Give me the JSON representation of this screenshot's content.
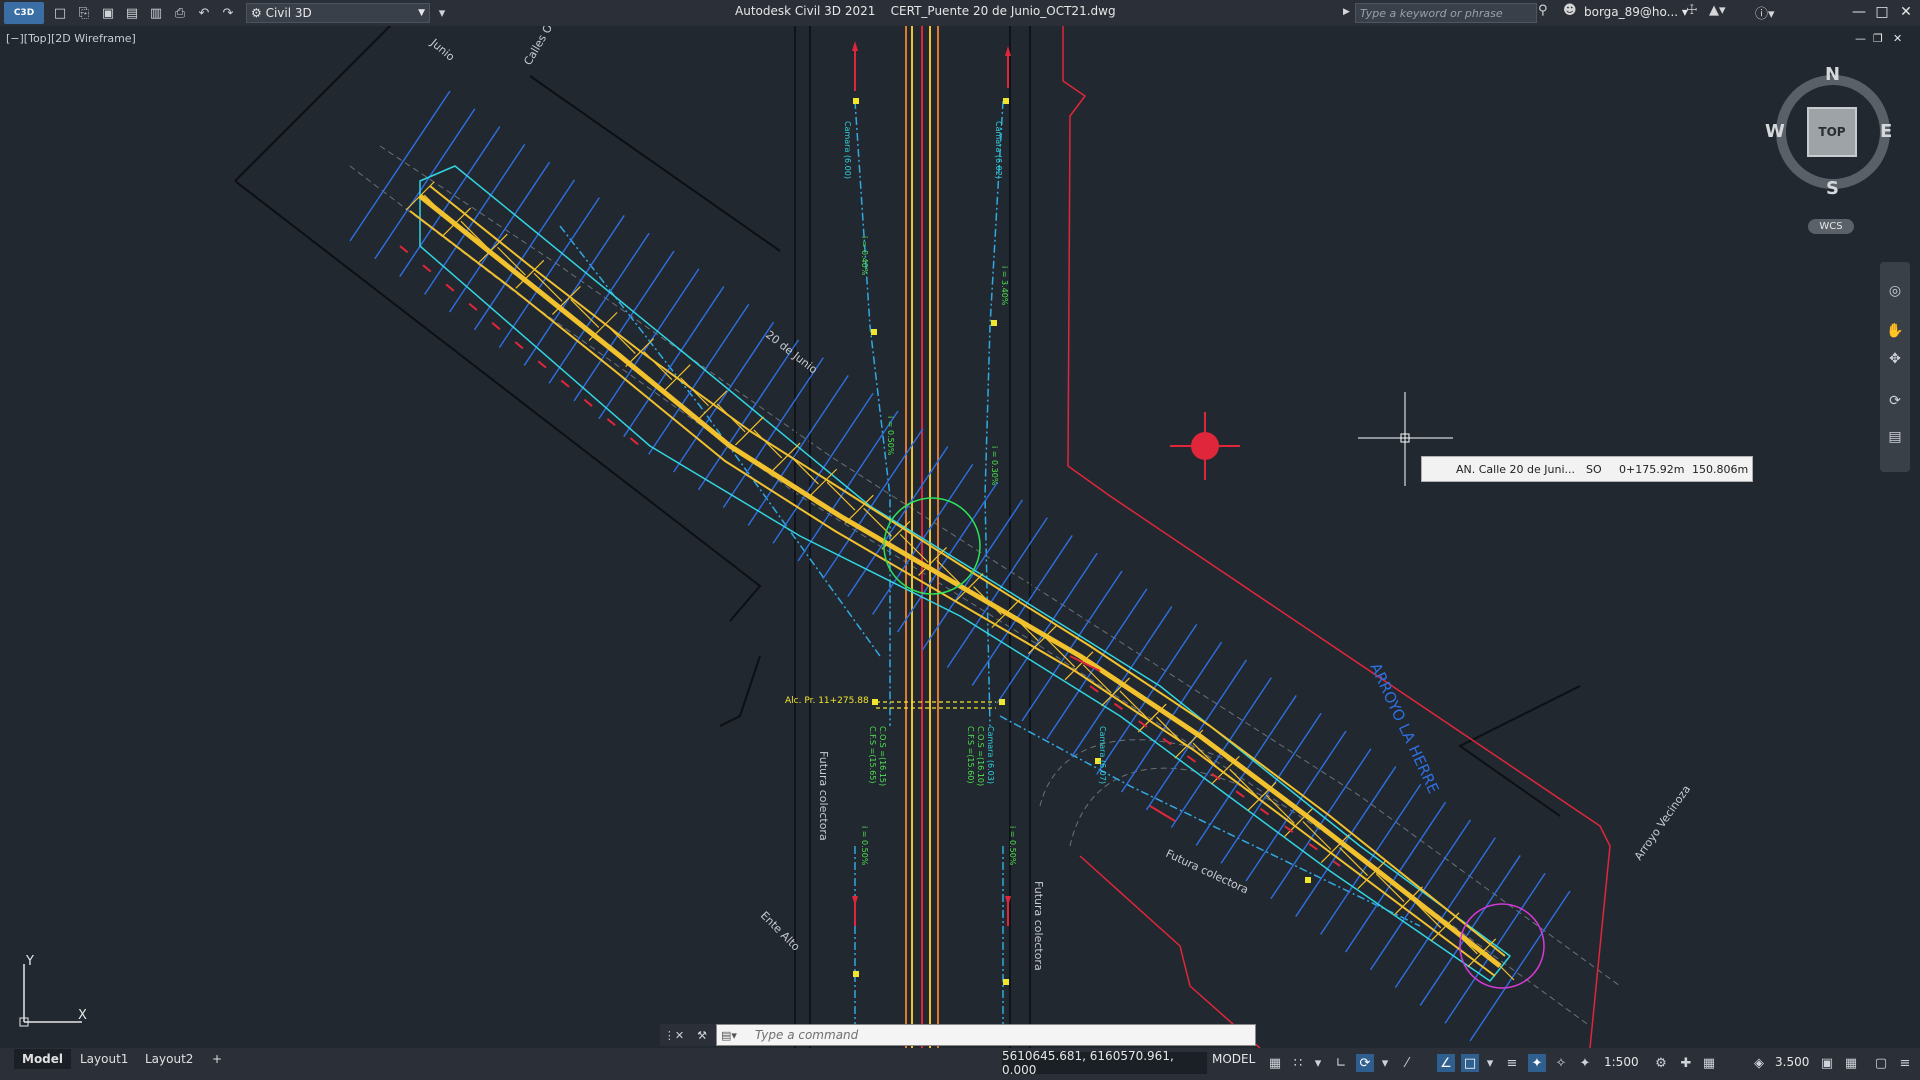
{
  "titlebar": {
    "app_badge": "C3D",
    "workspace": "Civil 3D",
    "app_name": "Autodesk Civil 3D 2021",
    "file_name": "CERT_Puente 20 de Junio_OCT21.dwg",
    "search_placeholder": "Type a keyword or phrase",
    "user": "borga_89@ho..."
  },
  "viewport": {
    "label": "[−][Top][2D Wireframe]"
  },
  "viewcube": {
    "top": "TOP",
    "north": "N",
    "south": "S",
    "east": "E",
    "west": "W",
    "wcs": "WCS"
  },
  "tooltip": {
    "alignment": "AN. Calle 20 de Juni...",
    "offset_side": "SO",
    "station": "0+175.92m",
    "offset": "150.806m"
  },
  "drawing": {
    "street_labels": [
      "20 de Junio",
      "Calles O.",
      "Junio",
      "Ente Alto",
      "Arroyo Vecinoza"
    ],
    "annotation_lines": [
      "Futura colectora",
      "Futura colectora",
      "Futura colectora"
    ],
    "station_label": "Alc. Pr. 11+275.88",
    "stream_label": "ARROYO LA HERRE",
    "cameras": [
      "Camara (6.00)",
      "Camara (6.02)",
      "Camara (6.03)",
      "Camara (6.07)"
    ],
    "pendientes": [
      "i = 0.40%",
      "i = 3.40%",
      "i = 0.50%",
      "i = 0.30%",
      "i = 0.50%",
      "i = 0.50%"
    ],
    "cota_labels": [
      "C.O.S =(16.15)",
      "C.F.S =(15.65)",
      "C.O.S =(16.10)",
      "C.F.S =(15.60)"
    ],
    "accent_colors": {
      "bridge": "#f2c12e",
      "section_lines": "#2f6fe0",
      "road_axis": "#e07a2c",
      "boundary": "#e0263a",
      "circle_green": "#2ee05a",
      "circle_magenta": "#d63ad6",
      "text_cyan": "#32d4e0",
      "text_green": "#4fe04f"
    }
  },
  "command_line": {
    "placeholder": "Type  a  command"
  },
  "layout_tabs": [
    "Model",
    "Layout1",
    "Layout2",
    "+"
  ],
  "status": {
    "coordinates": "5610645.681, 6160570.961, 0.000",
    "space": "MODEL",
    "scale": "1:500",
    "annotation_value": "3.500"
  },
  "ucs": {
    "x": "X",
    "y": "Y"
  }
}
